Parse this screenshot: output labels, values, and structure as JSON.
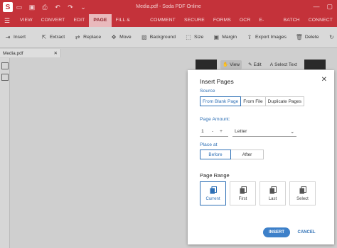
{
  "window": {
    "title": "Media.pdf - Soda PDF Online",
    "logo": "S"
  },
  "menubar": {
    "items": [
      "VIEW",
      "CONVERT",
      "EDIT",
      "PAGE",
      "FILL & SIGN",
      "COMMENT",
      "SECURE",
      "FORMS",
      "OCR",
      "E-SIGN",
      "BATCH",
      "CONNECT"
    ],
    "active": "PAGE"
  },
  "toolbar": {
    "tools": [
      {
        "label": "Insert",
        "icon": "insert-icon"
      },
      {
        "label": "Extract",
        "icon": "extract-icon"
      },
      {
        "label": "Replace",
        "icon": "replace-icon"
      },
      {
        "label": "Move",
        "icon": "move-icon"
      },
      {
        "label": "Background",
        "icon": "background-icon"
      },
      {
        "label": "Size",
        "icon": "size-icon"
      },
      {
        "label": "Margin",
        "icon": "margin-icon"
      },
      {
        "label": "Export Images",
        "icon": "export-images-icon"
      },
      {
        "label": "Delete",
        "icon": "delete-icon"
      },
      {
        "label": "Rotate",
        "icon": "rotate-icon"
      }
    ]
  },
  "tab": {
    "label": "Media.pdf",
    "close": "✕"
  },
  "viewbar": {
    "view": "View",
    "edit": "Edit",
    "select_text": "Select Text"
  },
  "dialog": {
    "title": "Insert Pages",
    "close": "✕",
    "source_label": "Source",
    "source_options": [
      "From Blank Page",
      "From File",
      "Duplicate Pages"
    ],
    "source_selected": "From Blank Page",
    "amount_label": "Page Amount:",
    "amount_value": "1",
    "stepper_minus": "-",
    "stepper_plus": "+",
    "page_size": "Letter",
    "place_label": "Place at",
    "place_options": [
      "Before",
      "After"
    ],
    "place_selected": "Before",
    "range_label": "Page Range",
    "range_options": [
      "Current",
      "First",
      "Last",
      "Select"
    ],
    "range_selected": "Current",
    "insert_button": "INSERT",
    "cancel_button": "CANCEL"
  },
  "colors": {
    "brand": "#c4323a",
    "accent": "#2d6fb5",
    "button": "#3d80c9"
  }
}
